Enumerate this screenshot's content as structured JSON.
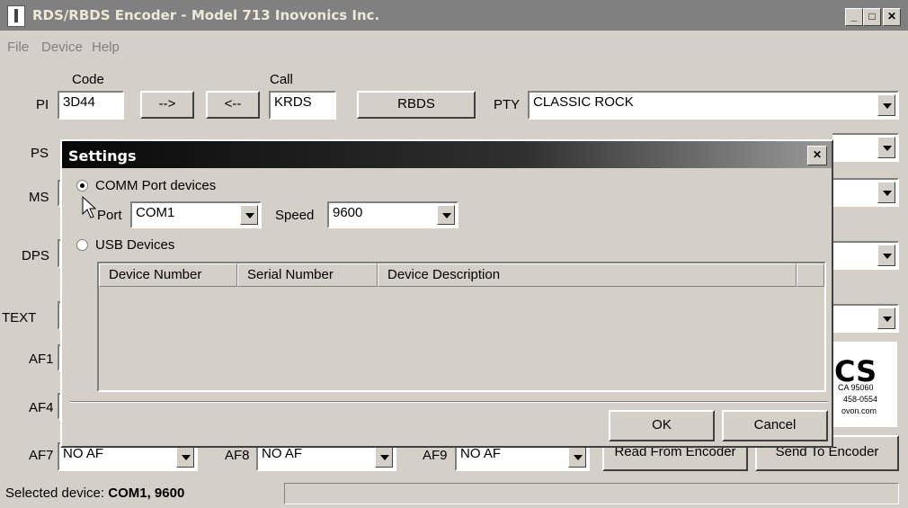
{
  "window": {
    "title": "RDS/RBDS Encoder - Model 713 Inovonics Inc."
  },
  "menu": [
    "File",
    "Device",
    "Help"
  ],
  "main": {
    "code_label": "Code",
    "call_label": "Call",
    "pi_label": "PI",
    "pi_value": "3D44",
    "arrow_right": "-->",
    "arrow_left": "<--",
    "call_value": "KRDS",
    "rbds_button": "RBDS",
    "pty_label": "PTY",
    "pty_value": "CLASSIC ROCK",
    "row_labels": {
      "ps": "PS",
      "ms": "MS",
      "dps": "DPS",
      "text": "TEXT",
      "af1": "AF1",
      "af4": "AF4",
      "af7": "AF7",
      "af8": "AF8",
      "af9": "AF9"
    },
    "af7_value": "NO AF",
    "af8_value": "NO AF",
    "af9_value": "NO AF",
    "read_button": "Read From Encoder",
    "send_button": "Send To Encoder",
    "logo": {
      "text": "CS",
      "line1": "CA  95060",
      "line2": "458-0554",
      "line3": "ovon.com"
    }
  },
  "dialog": {
    "title": "Settings",
    "comm_radio_label": "COMM Port devices",
    "comm_selected": true,
    "port_label": "Port",
    "port_value": "COM1",
    "speed_label": "Speed",
    "speed_value": "9600",
    "usb_radio_label": "USB Devices",
    "columns": [
      "Device Number",
      "Serial Number",
      "Device Description"
    ],
    "ok_label": "OK",
    "cancel_label": "Cancel"
  },
  "status": {
    "prefix": "Selected device: ",
    "value": "COM1, 9600"
  }
}
